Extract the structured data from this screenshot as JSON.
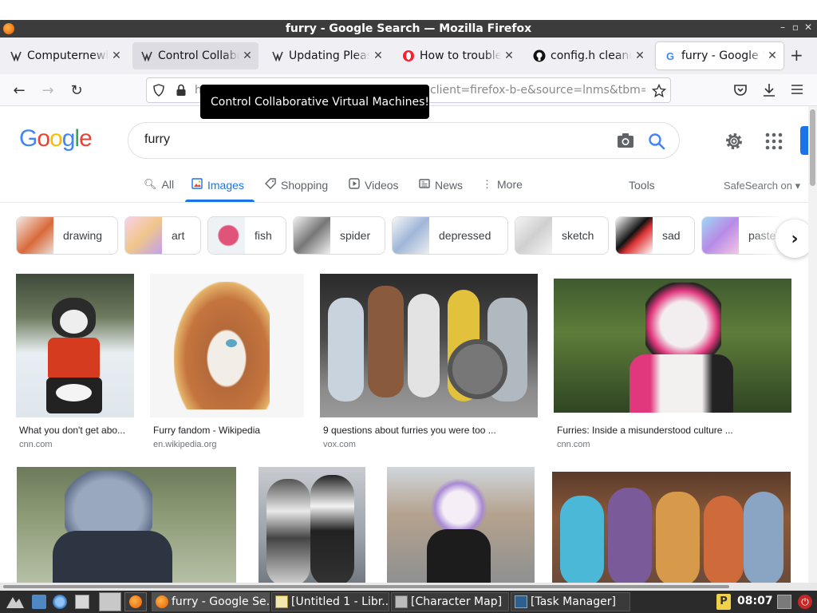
{
  "window": {
    "title": "furry - Google Search — Mozilla Firefox",
    "controls": [
      "–",
      "▫",
      "✕"
    ]
  },
  "tabs": [
    {
      "label": "Computernewb's",
      "icon": "wiki-icon",
      "state": "normal"
    },
    {
      "label": "Control Collabo",
      "icon": "wiki-icon",
      "state": "hover"
    },
    {
      "label": "Updating Please",
      "icon": "wiki-icon",
      "state": "normal"
    },
    {
      "label": "How to troubles",
      "icon": "opera-icon",
      "state": "normal"
    },
    {
      "label": "config.h cleanup",
      "icon": "github-icon",
      "state": "normal"
    },
    {
      "label": "furry - Google S",
      "icon": "google-icon",
      "state": "active"
    }
  ],
  "navbar": {
    "url_start": "h",
    "url_visible": "client=firefox-b-e&source=lnms&tbm="
  },
  "tooltip": "Control Collaborative Virtual Machines!",
  "google": {
    "logo": [
      "G",
      "o",
      "o",
      "g",
      "l",
      "e"
    ],
    "logo_colors": [
      "#4285f4",
      "#ea4335",
      "#fbbc05",
      "#4285f4",
      "#34a853",
      "#ea4335"
    ],
    "query": "furry",
    "tabs": [
      {
        "label": "All",
        "icon": "search-icon"
      },
      {
        "label": "Images",
        "icon": "images-icon",
        "active": true
      },
      {
        "label": "Shopping",
        "icon": "tag-icon"
      },
      {
        "label": "Videos",
        "icon": "play-icon"
      },
      {
        "label": "News",
        "icon": "news-icon"
      },
      {
        "label": "More",
        "icon": "more-icon"
      }
    ],
    "tools": "Tools",
    "safesearch": "SafeSearch on",
    "chips": [
      "drawing",
      "art",
      "fish",
      "spider",
      "depressed",
      "sketch",
      "sad",
      "pastel"
    ],
    "results": [
      {
        "title": "What you don't get abo...",
        "source": "cnn.com"
      },
      {
        "title": "Furry fandom - Wikipedia",
        "source": "en.wikipedia.org"
      },
      {
        "title": "9 questions about furries you were too ...",
        "source": "vox.com"
      },
      {
        "title": "Furries: Inside a misunderstood culture ...",
        "source": "cnn.com"
      },
      {
        "title": "",
        "source": ""
      },
      {
        "title": "",
        "source": ""
      },
      {
        "title": "",
        "source": ""
      },
      {
        "title": "",
        "source": ""
      }
    ]
  },
  "taskbar": {
    "items": [
      {
        "label": "furry - Google Se...",
        "active": true
      },
      {
        "label": "[Untitled 1 - Libr..."
      },
      {
        "label": "[Character Map]"
      },
      {
        "label": "[Task Manager]"
      }
    ],
    "clock": "08:07"
  },
  "colors": {
    "accent": "#1a73e8",
    "taskbar": "#2b2b2b",
    "titlebar": "#3c3c3c"
  }
}
